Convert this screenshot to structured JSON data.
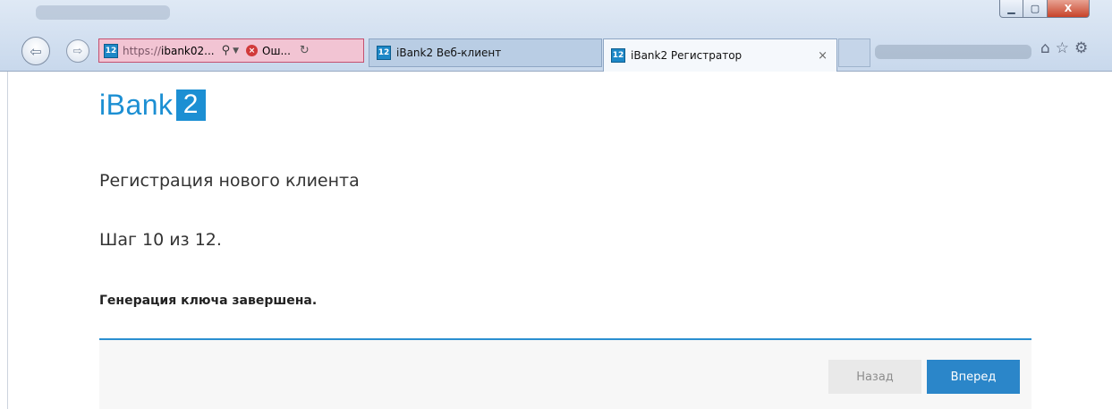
{
  "browser": {
    "window_controls": {
      "minimize": "▁",
      "maximize": "▢",
      "close": "X"
    },
    "nav": {
      "back_icon": "⇦",
      "forward_icon": "⇨"
    },
    "address": {
      "favicon": "12",
      "scheme": "https://",
      "host": "ibank02...",
      "search_icon": "⚲",
      "dropdown_icon": "▼",
      "error_icon": "×",
      "error_text": "Ош...",
      "refresh_icon": "↻"
    },
    "tabs": [
      {
        "favicon": "12",
        "label": "iBank2 Веб-клиент"
      },
      {
        "favicon": "12",
        "label": "iBank2 Регистратор",
        "close": "×"
      }
    ],
    "tools": {
      "home_icon": "⌂",
      "star_icon": "☆",
      "gear_icon": "⚙"
    }
  },
  "page": {
    "logo": {
      "text": "iBank",
      "number": "2"
    },
    "heading": "Регистрация нового клиента",
    "step": "Шаг 10 из 12.",
    "message": "Генерация ключа завершена.",
    "buttons": {
      "back": "Назад",
      "next": "Вперед"
    }
  },
  "colors": {
    "brand": "#1c8fd3",
    "primary_button": "#2b86c9",
    "divider": "#2a8fd0",
    "address_error_bg": "#f2c4d3"
  }
}
